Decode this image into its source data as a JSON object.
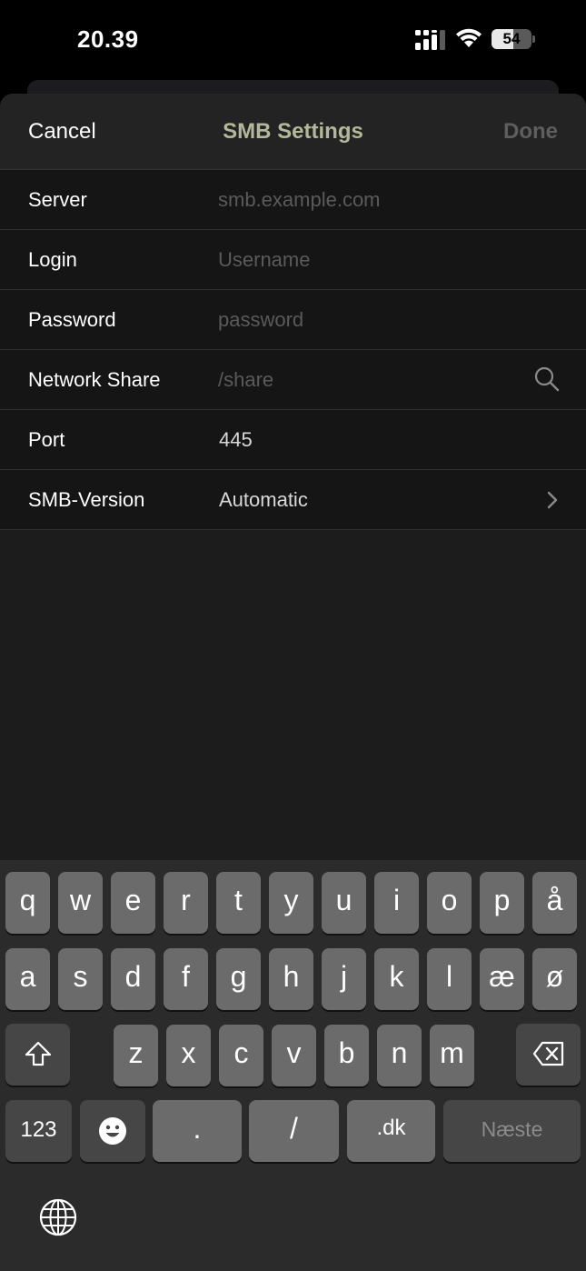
{
  "status_bar": {
    "time": "20.39",
    "battery_percent": "54",
    "battery_level": 0.54,
    "icons": [
      "cellular-signal-icon",
      "wifi-icon",
      "battery-icon"
    ]
  },
  "nav": {
    "cancel_label": "Cancel",
    "title": "SMB Settings",
    "done_label": "Done"
  },
  "form": {
    "server": {
      "label": "Server",
      "value": "",
      "placeholder": "smb.example.com"
    },
    "login": {
      "label": "Login",
      "value": "",
      "placeholder": "Username"
    },
    "password": {
      "label": "Password",
      "value": "",
      "placeholder": "password"
    },
    "share": {
      "label": "Network Share",
      "value": "",
      "placeholder": "/share",
      "icon": "search-icon"
    },
    "port": {
      "label": "Port",
      "value": "445"
    },
    "version": {
      "label": "SMB-Version",
      "value": "Automatic",
      "icon": "chevron-right-icon"
    }
  },
  "keyboard": {
    "row1": [
      "q",
      "w",
      "e",
      "r",
      "t",
      "y",
      "u",
      "i",
      "o",
      "p",
      "å"
    ],
    "row2": [
      "a",
      "s",
      "d",
      "f",
      "g",
      "h",
      "j",
      "k",
      "l",
      "æ",
      "ø"
    ],
    "row3": [
      "z",
      "x",
      "c",
      "v",
      "b",
      "n",
      "m"
    ],
    "numbers_label": "123",
    "dot_label": ".",
    "slash_label": "/",
    "dk_label": ".dk",
    "next_label": "Næste",
    "icons": [
      "shift-icon",
      "delete-icon",
      "emoji-icon",
      "globe-icon"
    ]
  },
  "colors": {
    "title": "#b4b89a",
    "done_disabled": "#5e5e5e",
    "placeholder": "#5a5a5a"
  }
}
